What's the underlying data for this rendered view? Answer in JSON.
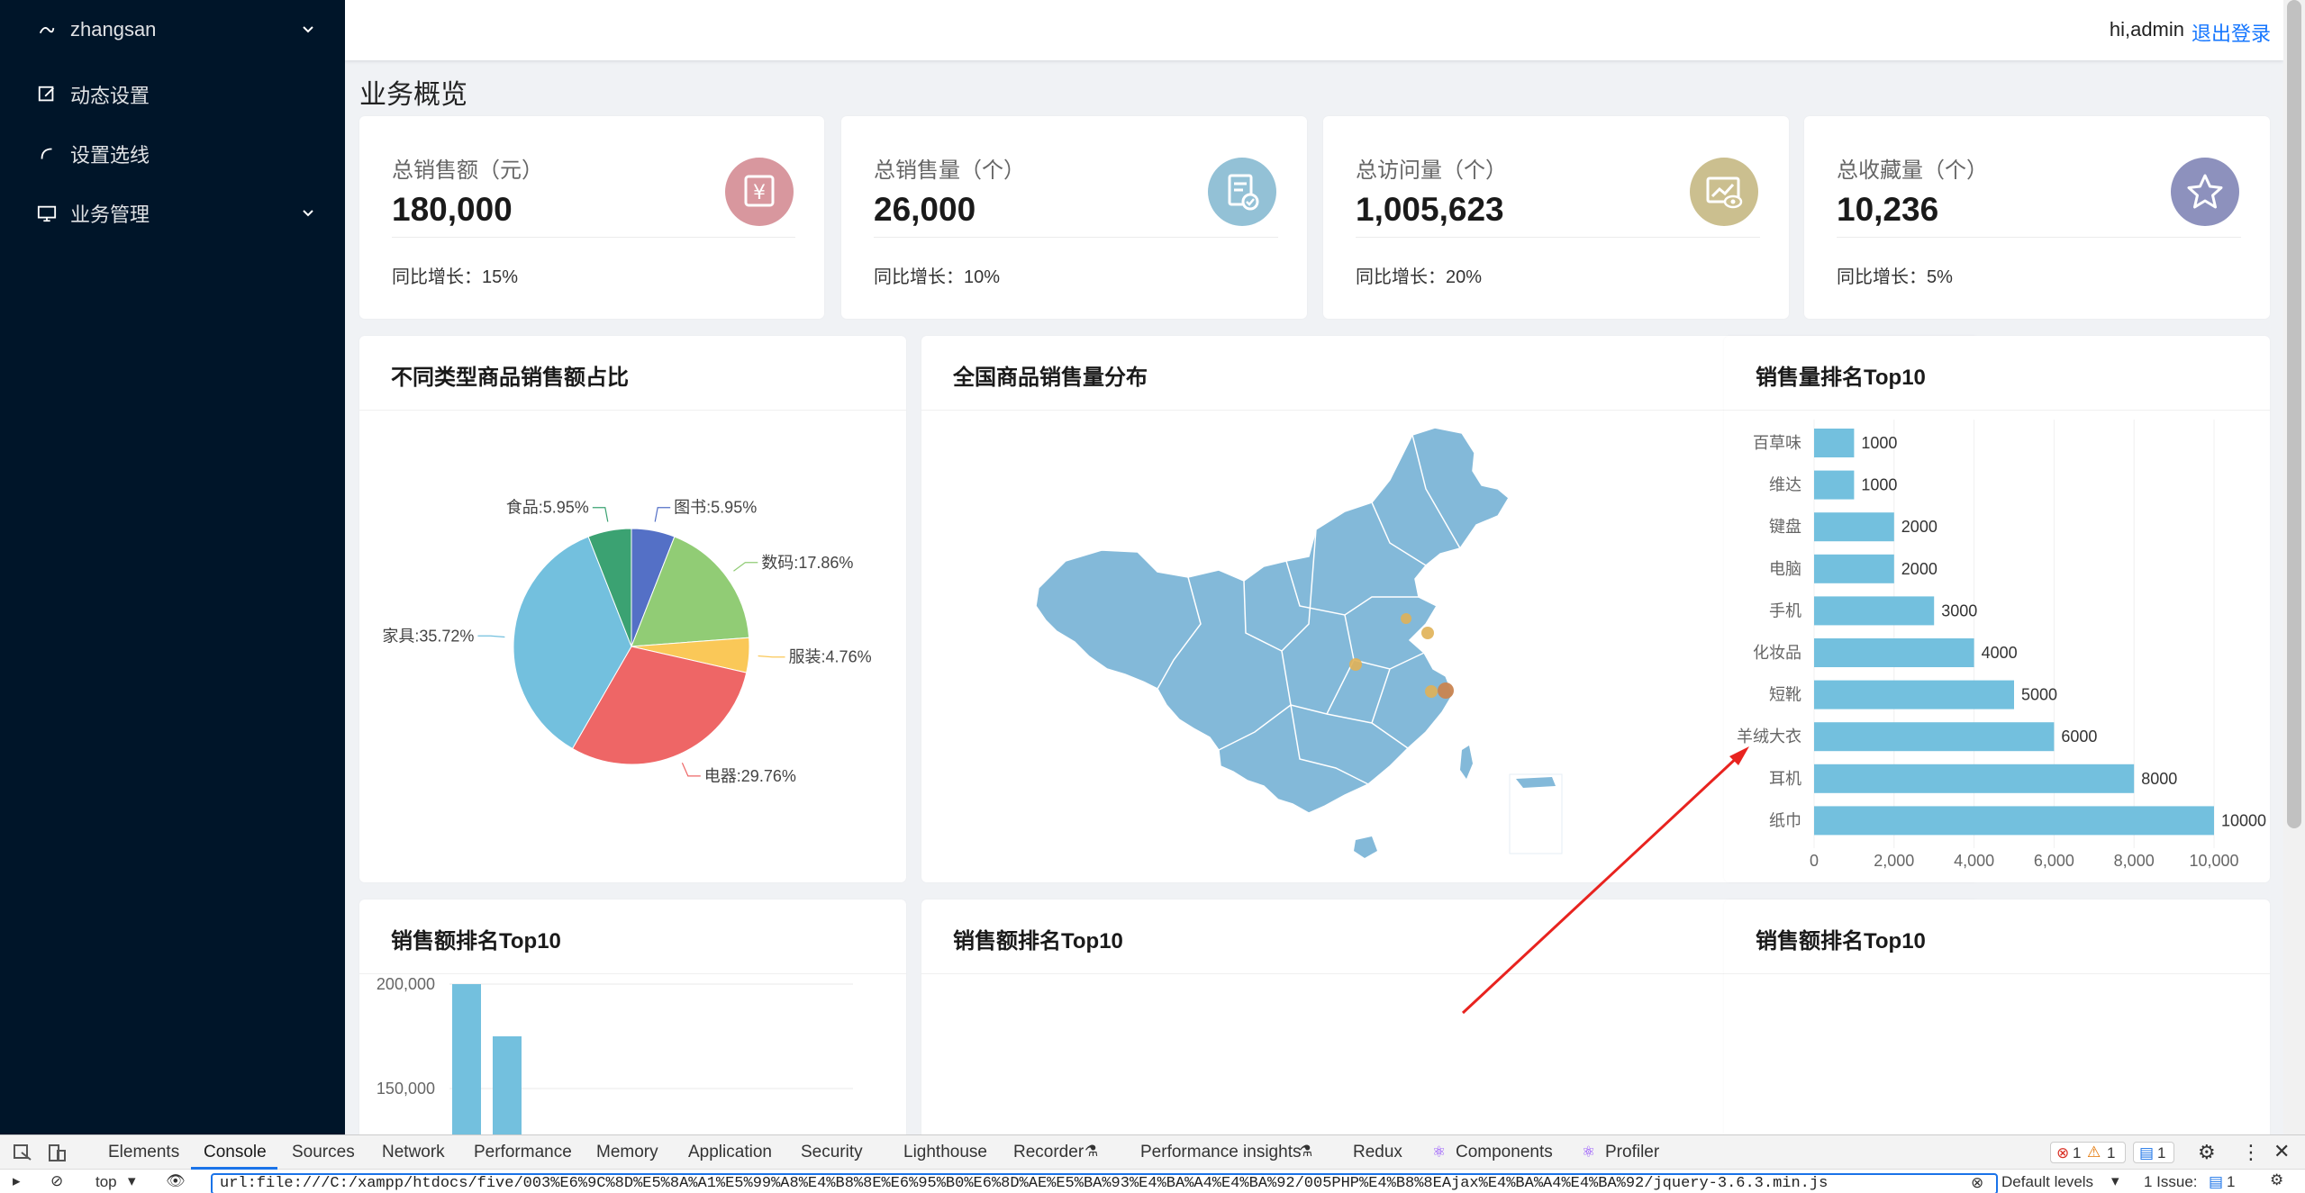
{
  "sidebar": {
    "user": "zhangsan",
    "items": [
      {
        "label": "动态设置"
      },
      {
        "label": "设置选线"
      },
      {
        "label": "业务管理"
      }
    ]
  },
  "header": {
    "greeting": "hi,admin",
    "logout": "退出登录"
  },
  "page": {
    "title": "业务概览"
  },
  "stats": [
    {
      "label": "总销售额（元）",
      "value": "180,000",
      "growth": "同比增长：15%",
      "color": "#d8979e",
      "icon": "yen-icon"
    },
    {
      "label": "总销售量（个）",
      "value": "26,000",
      "growth": "同比增长：10%",
      "color": "#93c1d6",
      "icon": "document-check-icon"
    },
    {
      "label": "总访问量（个）",
      "value": "1,005,623",
      "growth": "同比增长：20%",
      "color": "#cbbf8f",
      "icon": "chart-eye-icon"
    },
    {
      "label": "总收藏量（个）",
      "value": "10,236",
      "growth": "同比增长：5%",
      "color": "#8d91bd",
      "icon": "star-icon"
    }
  ],
  "panels": {
    "pie_title": "不同类型商品销售额占比",
    "map_title": "全国商品销售量分布",
    "bar_title": "销售量排名Top10",
    "sales_title_1": "销售额排名Top10",
    "sales_title_2": "销售额排名Top10",
    "sales_title_3": "销售额排名Top10"
  },
  "chart_data": [
    {
      "type": "pie",
      "title": "不同类型商品销售额占比",
      "slices": [
        {
          "name": "图书",
          "value": 5.95,
          "label": "图书:5.95%",
          "color": "#5470c6"
        },
        {
          "name": "数码",
          "value": 17.86,
          "label": "数码:17.86%",
          "color": "#91cc75"
        },
        {
          "name": "服装",
          "value": 4.76,
          "label": "服装:4.76%",
          "color": "#fac858"
        },
        {
          "name": "电器",
          "value": 29.76,
          "label": "电器:29.76%",
          "color": "#ee6666"
        },
        {
          "name": "家具",
          "value": 35.72,
          "label": "家具:35.72%",
          "color": "#73c0de"
        },
        {
          "name": "食品",
          "value": 5.95,
          "label": "食品:5.95%",
          "color": "#3ba272"
        }
      ]
    },
    {
      "type": "bar",
      "orientation": "horizontal",
      "title": "销售量排名Top10",
      "categories": [
        "百草味",
        "维达",
        "键盘",
        "电脑",
        "手机",
        "化妆品",
        "短靴",
        "羊绒大衣",
        "耳机",
        "纸巾"
      ],
      "values": [
        1000,
        1000,
        2000,
        2000,
        3000,
        4000,
        5000,
        6000,
        8000,
        10000
      ],
      "xlim": [
        0,
        10000
      ],
      "xticks": [
        "0",
        "2,000",
        "4,000",
        "6,000",
        "8,000",
        "10,000"
      ],
      "color": "#73c0de"
    },
    {
      "type": "bar",
      "title": "销售额排名Top10",
      "values": [
        200000,
        175000
      ],
      "ylim": [
        100000,
        200000
      ],
      "yticks": [
        "200,000",
        "150,000"
      ],
      "color": "#73c0de"
    }
  ],
  "devtools": {
    "tabs": [
      "Elements",
      "Console",
      "Sources",
      "Network",
      "Performance",
      "Memory",
      "Application",
      "Security",
      "Lighthouse",
      "Recorder",
      "Performance insights",
      "Redux",
      "Components",
      "Profiler"
    ],
    "context": "top",
    "filter": "url:file:///C:/xampp/htdocs/five/003%E6%9C%8D%E5%8A%A1%E5%99%A8%E4%B8%8E%E6%95%B0%E6%8D%AE%E5%BA%93%E4%BA%A4%E4%BA%92/005PHP%E4%B8%8EAjax%E4%BA%A4%E4%BA%92/jquery-3.6.3.min.js",
    "levels": "Default levels",
    "issues": "1 Issue:",
    "issue_count": "1",
    "errors": "1",
    "warnings": "1",
    "messages": "1"
  }
}
